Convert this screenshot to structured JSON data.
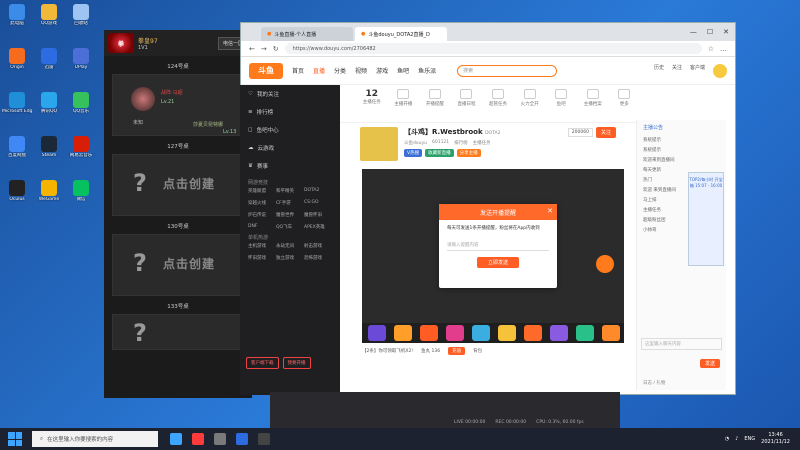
{
  "desktop_icons": [
    {
      "label": "此电脑",
      "color": "#3b8be8"
    },
    {
      "label": "Origin",
      "color": "#f56c1f"
    },
    {
      "label": "Microsoft Edge",
      "color": "#1f8fd8"
    },
    {
      "label": "百度网盘",
      "color": "#3f88f6"
    },
    {
      "label": "Oculus",
      "color": "#222"
    },
    {
      "label": "QQ游戏",
      "color": "#f2b83a"
    },
    {
      "label": "迅雷",
      "color": "#2d6ce0"
    },
    {
      "label": "腾讯QQ",
      "color": "#2aa6ed"
    },
    {
      "label": "Steam",
      "color": "#1b2838"
    },
    {
      "label": "WeGame",
      "color": "#f5b400"
    },
    {
      "label": "回收站",
      "color": "#9ec4f2"
    },
    {
      "label": "UPlay",
      "color": "#4b6fd6"
    },
    {
      "label": "QQ音乐",
      "color": "#35c25c"
    },
    {
      "label": "网易云音乐",
      "color": "#d81e06"
    },
    {
      "label": "微信",
      "color": "#07c160"
    }
  ],
  "game": {
    "title": "拳皇97",
    "mode": "1V1",
    "region": "电信一区",
    "tables": [
      "124号桌",
      "127号桌",
      "130号桌",
      "133号桌"
    ],
    "player": {
      "name": "战阵·马超",
      "level": "Lv.21",
      "side": "准备"
    },
    "opponent": {
      "name": "莎夏贝昆特娜",
      "level": "Lv.13"
    },
    "create_label": "点击创建",
    "unready": "未知"
  },
  "browser": {
    "tabs": [
      {
        "title": "斗鱼直播-个人直播",
        "active": false
      },
      {
        "title": "斗鱼douyu_DOTA2直播_D",
        "active": true
      }
    ],
    "url": "https://www.douyu.com/2706482",
    "logo": "斗鱼",
    "nav": [
      "首页",
      "直播",
      "分类",
      "视频",
      "游戏",
      "鱼吧",
      "鱼乐派"
    ],
    "search_placeholder": "搜索",
    "head_actions": [
      "历史",
      "关注",
      "客户端"
    ]
  },
  "left_panel": {
    "items": [
      "我的关注",
      "排行榜",
      "鱼吧中心",
      "云游戏",
      "赛事"
    ],
    "section": "网游竞技",
    "games": [
      "英雄联盟",
      "和平精英",
      "DOTA2",
      "穿越火线",
      "CF手游",
      "CS:GO",
      "炉石传说",
      "魔兽世界",
      "魔兽怀旧",
      "DNF",
      "QQ飞车",
      "APEX英雄"
    ],
    "section2": "单机热游",
    "games2": [
      "主机游戏",
      "永劫无间",
      "射击游戏",
      "怀旧游戏",
      "独立游戏",
      "恐怖游戏"
    ],
    "btn1": "客户端下载",
    "btn2": "我要开播"
  },
  "categories": [
    {
      "label": "12",
      "sub": "主播任务"
    },
    {
      "label": "主播开播"
    },
    {
      "label": "开播提醒"
    },
    {
      "label": "直播日程"
    },
    {
      "label": "超管任务"
    },
    {
      "label": "火力全开"
    },
    {
      "label": "鱼吧"
    },
    {
      "label": "主播档案"
    },
    {
      "label": "更多"
    }
  ],
  "streamer": {
    "title": "【斗鸡】R.Westbrook",
    "category": "DOTA2",
    "meta": [
      "斗鱼douyu",
      "601121",
      "排行榜",
      "主播任务"
    ],
    "tags": [
      "V热搜",
      "收藏新直播",
      "分享主播"
    ],
    "follow_count": "200060",
    "follow_label": "关注"
  },
  "modal": {
    "title": "发送开播提醒",
    "body": "每天可发送1条开播提醒，粉丝将在App内收到",
    "input_placeholder": "请输入提醒内容",
    "button": "立即发送"
  },
  "info_row": [
    "【2条】你可领取飞机X2!",
    "鱼丸 136",
    "充值",
    "背包"
  ],
  "chat": {
    "title": "主播公告",
    "lines": [
      "系统提示",
      "系统提示",
      "欢迎来到直播间",
      "每天更新",
      "热门",
      "欢迎 来到直播间",
      "马上排",
      "主播任务",
      "超级粉丝团",
      "小帅哥"
    ],
    "input_placeholder": "这里输入聊天内容",
    "send": "发送",
    "sub": "日志 / 礼物"
  },
  "rank": {
    "text": "TOP2/每小时 开宝箱 15:07 - 16:00"
  },
  "obs": {
    "stats": [
      "LIVE 00:00:00",
      "REC 00:00:00",
      "CPU: 0.3%, 60.00 fps"
    ]
  },
  "taskbar": {
    "search": "在这里输入你要搜索的内容",
    "apps": [
      {
        "color": "#3da4ff"
      },
      {
        "color": "#ff3b3b"
      },
      {
        "color": "#7a7a7a"
      },
      {
        "color": "#2d6ce0"
      },
      {
        "color": "#444"
      }
    ],
    "lang": "ENG",
    "time": "13:46",
    "date": "2021/11/12"
  }
}
